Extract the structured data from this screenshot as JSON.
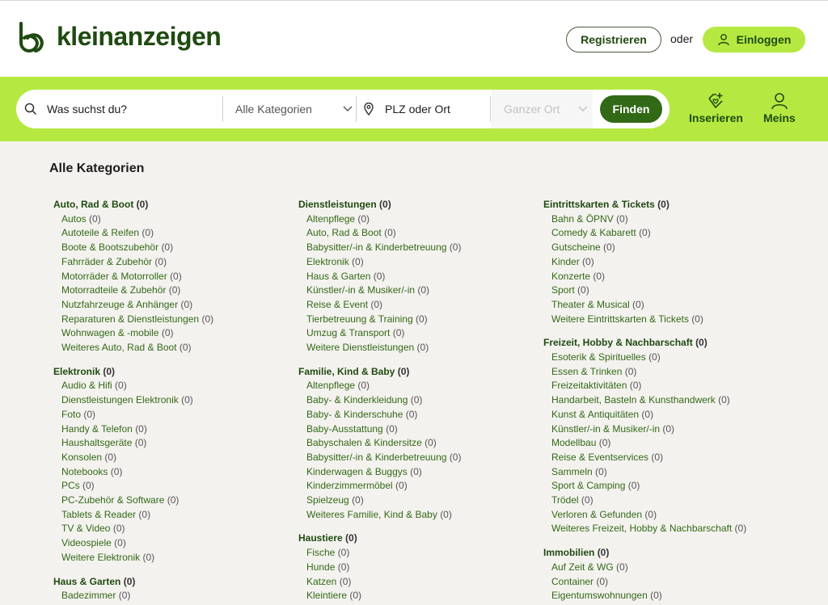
{
  "header": {
    "logo_text": "kleinanzeigen",
    "register_label": "Registrieren",
    "or_label": "oder",
    "login_label": "Einloggen"
  },
  "search": {
    "query_placeholder": "Was suchst du?",
    "category_select": "Alle Kategorien",
    "location_placeholder": "PLZ oder Ort",
    "radius_select": "Ganzer Ort",
    "find_label": "Finden",
    "post_label": "Inserieren",
    "account_label": "Meins"
  },
  "page_title": "Alle Kategorien",
  "columns": [
    [
      {
        "name": "Auto, Rad & Boot",
        "count": "(0)",
        "items": [
          [
            "Autos",
            "(0)"
          ],
          [
            "Autoteile & Reifen",
            "(0)"
          ],
          [
            "Boote & Bootszubehör",
            "(0)"
          ],
          [
            "Fahrräder & Zubehör",
            "(0)"
          ],
          [
            "Motorräder & Motorroller",
            "(0)"
          ],
          [
            "Motorradteile & Zubehör",
            "(0)"
          ],
          [
            "Nutzfahrzeuge & Anhänger",
            "(0)"
          ],
          [
            "Reparaturen & Dienstleistungen",
            "(0)"
          ],
          [
            "Wohnwagen & -mobile",
            "(0)"
          ],
          [
            "Weiteres Auto, Rad & Boot",
            "(0)"
          ]
        ]
      },
      {
        "name": "Elektronik",
        "count": "(0)",
        "items": [
          [
            "Audio & Hifi",
            "(0)"
          ],
          [
            "Dienstleistungen Elektronik",
            "(0)"
          ],
          [
            "Foto",
            "(0)"
          ],
          [
            "Handy & Telefon",
            "(0)"
          ],
          [
            "Haushaltsgeräte",
            "(0)"
          ],
          [
            "Konsolen",
            "(0)"
          ],
          [
            "Notebooks",
            "(0)"
          ],
          [
            "PCs",
            "(0)"
          ],
          [
            "PC-Zubehör & Software",
            "(0)"
          ],
          [
            "Tablets & Reader",
            "(0)"
          ],
          [
            "TV & Video",
            "(0)"
          ],
          [
            "Videospiele",
            "(0)"
          ],
          [
            "Weitere Elektronik",
            "(0)"
          ]
        ]
      },
      {
        "name": "Haus & Garten",
        "count": "(0)",
        "items": [
          [
            "Badezimmer",
            "(0)"
          ]
        ]
      }
    ],
    [
      {
        "name": "Dienstleistungen",
        "count": "(0)",
        "items": [
          [
            "Altenpflege",
            "(0)"
          ],
          [
            "Auto, Rad & Boot",
            "(0)"
          ],
          [
            "Babysitter/-in & Kinderbetreuung",
            "(0)"
          ],
          [
            "Elektronik",
            "(0)"
          ],
          [
            "Haus & Garten",
            "(0)"
          ],
          [
            "Künstler/-in & Musiker/-in",
            "(0)"
          ],
          [
            "Reise & Event",
            "(0)"
          ],
          [
            "Tierbetreuung & Training",
            "(0)"
          ],
          [
            "Umzug & Transport",
            "(0)"
          ],
          [
            "Weitere Dienstleistungen",
            "(0)"
          ]
        ]
      },
      {
        "name": "Familie, Kind & Baby",
        "count": "(0)",
        "items": [
          [
            "Altenpflege",
            "(0)"
          ],
          [
            "Baby- & Kinderkleidung",
            "(0)"
          ],
          [
            "Baby- & Kinderschuhe",
            "(0)"
          ],
          [
            "Baby-Ausstattung",
            "(0)"
          ],
          [
            "Babyschalen & Kindersitze",
            "(0)"
          ],
          [
            "Babysitter/-in & Kinderbetreuung",
            "(0)"
          ],
          [
            "Kinderwagen & Buggys",
            "(0)"
          ],
          [
            "Kinderzimmermöbel",
            "(0)"
          ],
          [
            "Spielzeug",
            "(0)"
          ],
          [
            "Weiteres Familie, Kind & Baby",
            "(0)"
          ]
        ]
      },
      {
        "name": "Haustiere",
        "count": "(0)",
        "items": [
          [
            "Fische",
            "(0)"
          ],
          [
            "Hunde",
            "(0)"
          ],
          [
            "Katzen",
            "(0)"
          ],
          [
            "Kleintiere",
            "(0)"
          ]
        ]
      }
    ],
    [
      {
        "name": "Eintrittskarten & Tickets",
        "count": "(0)",
        "items": [
          [
            "Bahn & ÖPNV",
            "(0)"
          ],
          [
            "Comedy & Kabarett",
            "(0)"
          ],
          [
            "Gutscheine",
            "(0)"
          ],
          [
            "Kinder",
            "(0)"
          ],
          [
            "Konzerte",
            "(0)"
          ],
          [
            "Sport",
            "(0)"
          ],
          [
            "Theater & Musical",
            "(0)"
          ],
          [
            "Weitere Eintrittskarten & Tickets",
            "(0)"
          ]
        ]
      },
      {
        "name": "Freizeit, Hobby & Nachbarschaft",
        "count": "(0)",
        "items": [
          [
            "Esoterik & Spirituelles",
            "(0)"
          ],
          [
            "Essen & Trinken",
            "(0)"
          ],
          [
            "Freizeitaktivitäten",
            "(0)"
          ],
          [
            "Handarbeit, Basteln & Kunsthandwerk",
            "(0)"
          ],
          [
            "Kunst & Antiquitäten",
            "(0)"
          ],
          [
            "Künstler/-in & Musiker/-in",
            "(0)"
          ],
          [
            "Modellbau",
            "(0)"
          ],
          [
            "Reise & Eventservices",
            "(0)"
          ],
          [
            "Sammeln",
            "(0)"
          ],
          [
            "Sport & Camping",
            "(0)"
          ],
          [
            "Trödel",
            "(0)"
          ],
          [
            "Verloren & Gefunden",
            "(0)"
          ],
          [
            "Weiteres Freizeit, Hobby & Nachbarschaft",
            "(0)"
          ]
        ]
      },
      {
        "name": "Immobilien",
        "count": "(0)",
        "items": [
          [
            "Auf Zeit & WG",
            "(0)"
          ],
          [
            "Container",
            "(0)"
          ],
          [
            "Eigentumswohnungen",
            "(0)"
          ]
        ]
      }
    ]
  ]
}
